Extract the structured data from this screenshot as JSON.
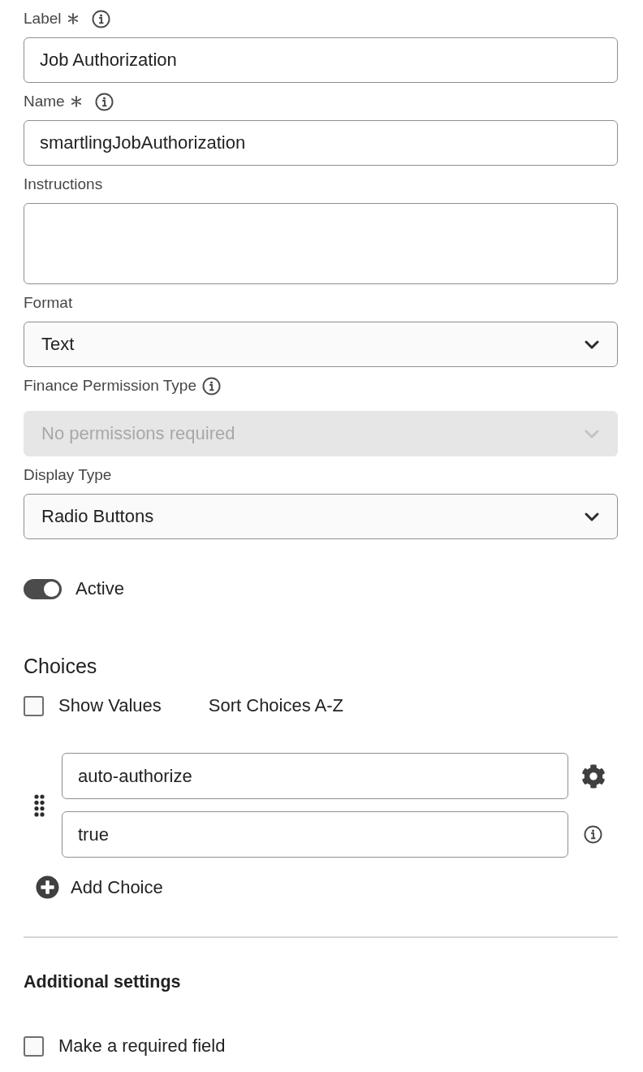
{
  "fields": [
    {
      "kind": "text",
      "label": "Label",
      "required": true,
      "info": true,
      "value": "Job Authorization",
      "disabled": false
    },
    {
      "kind": "text",
      "label": "Name",
      "required": true,
      "info": true,
      "value": "smartlingJobAuthorization",
      "disabled": false
    },
    {
      "kind": "textarea",
      "label": "Instructions",
      "required": false,
      "info": false,
      "disabled": false
    },
    {
      "kind": "select",
      "label": "Format",
      "required": false,
      "info": false,
      "value": "Text",
      "disabled": false
    },
    {
      "kind": "select",
      "label": "Finance Permission Type",
      "required": false,
      "info": true,
      "value": "No permissions required",
      "disabled": true
    },
    {
      "kind": "select",
      "label": "Display Type",
      "required": false,
      "info": false,
      "value": "Radio Buttons",
      "disabled": false
    }
  ],
  "active_toggle": {
    "label": "Active",
    "on": true
  },
  "choices": {
    "title": "Choices",
    "show_values": {
      "label": "Show Values",
      "checked": false
    },
    "sort_link": "Sort Choices A-Z",
    "items": [
      {
        "label": "auto-authorize",
        "value": "true"
      }
    ],
    "add_button": "Add Choice"
  },
  "additional_settings": {
    "title": "Additional settings",
    "required_field": {
      "label": "Make a required field",
      "checked": false
    }
  }
}
